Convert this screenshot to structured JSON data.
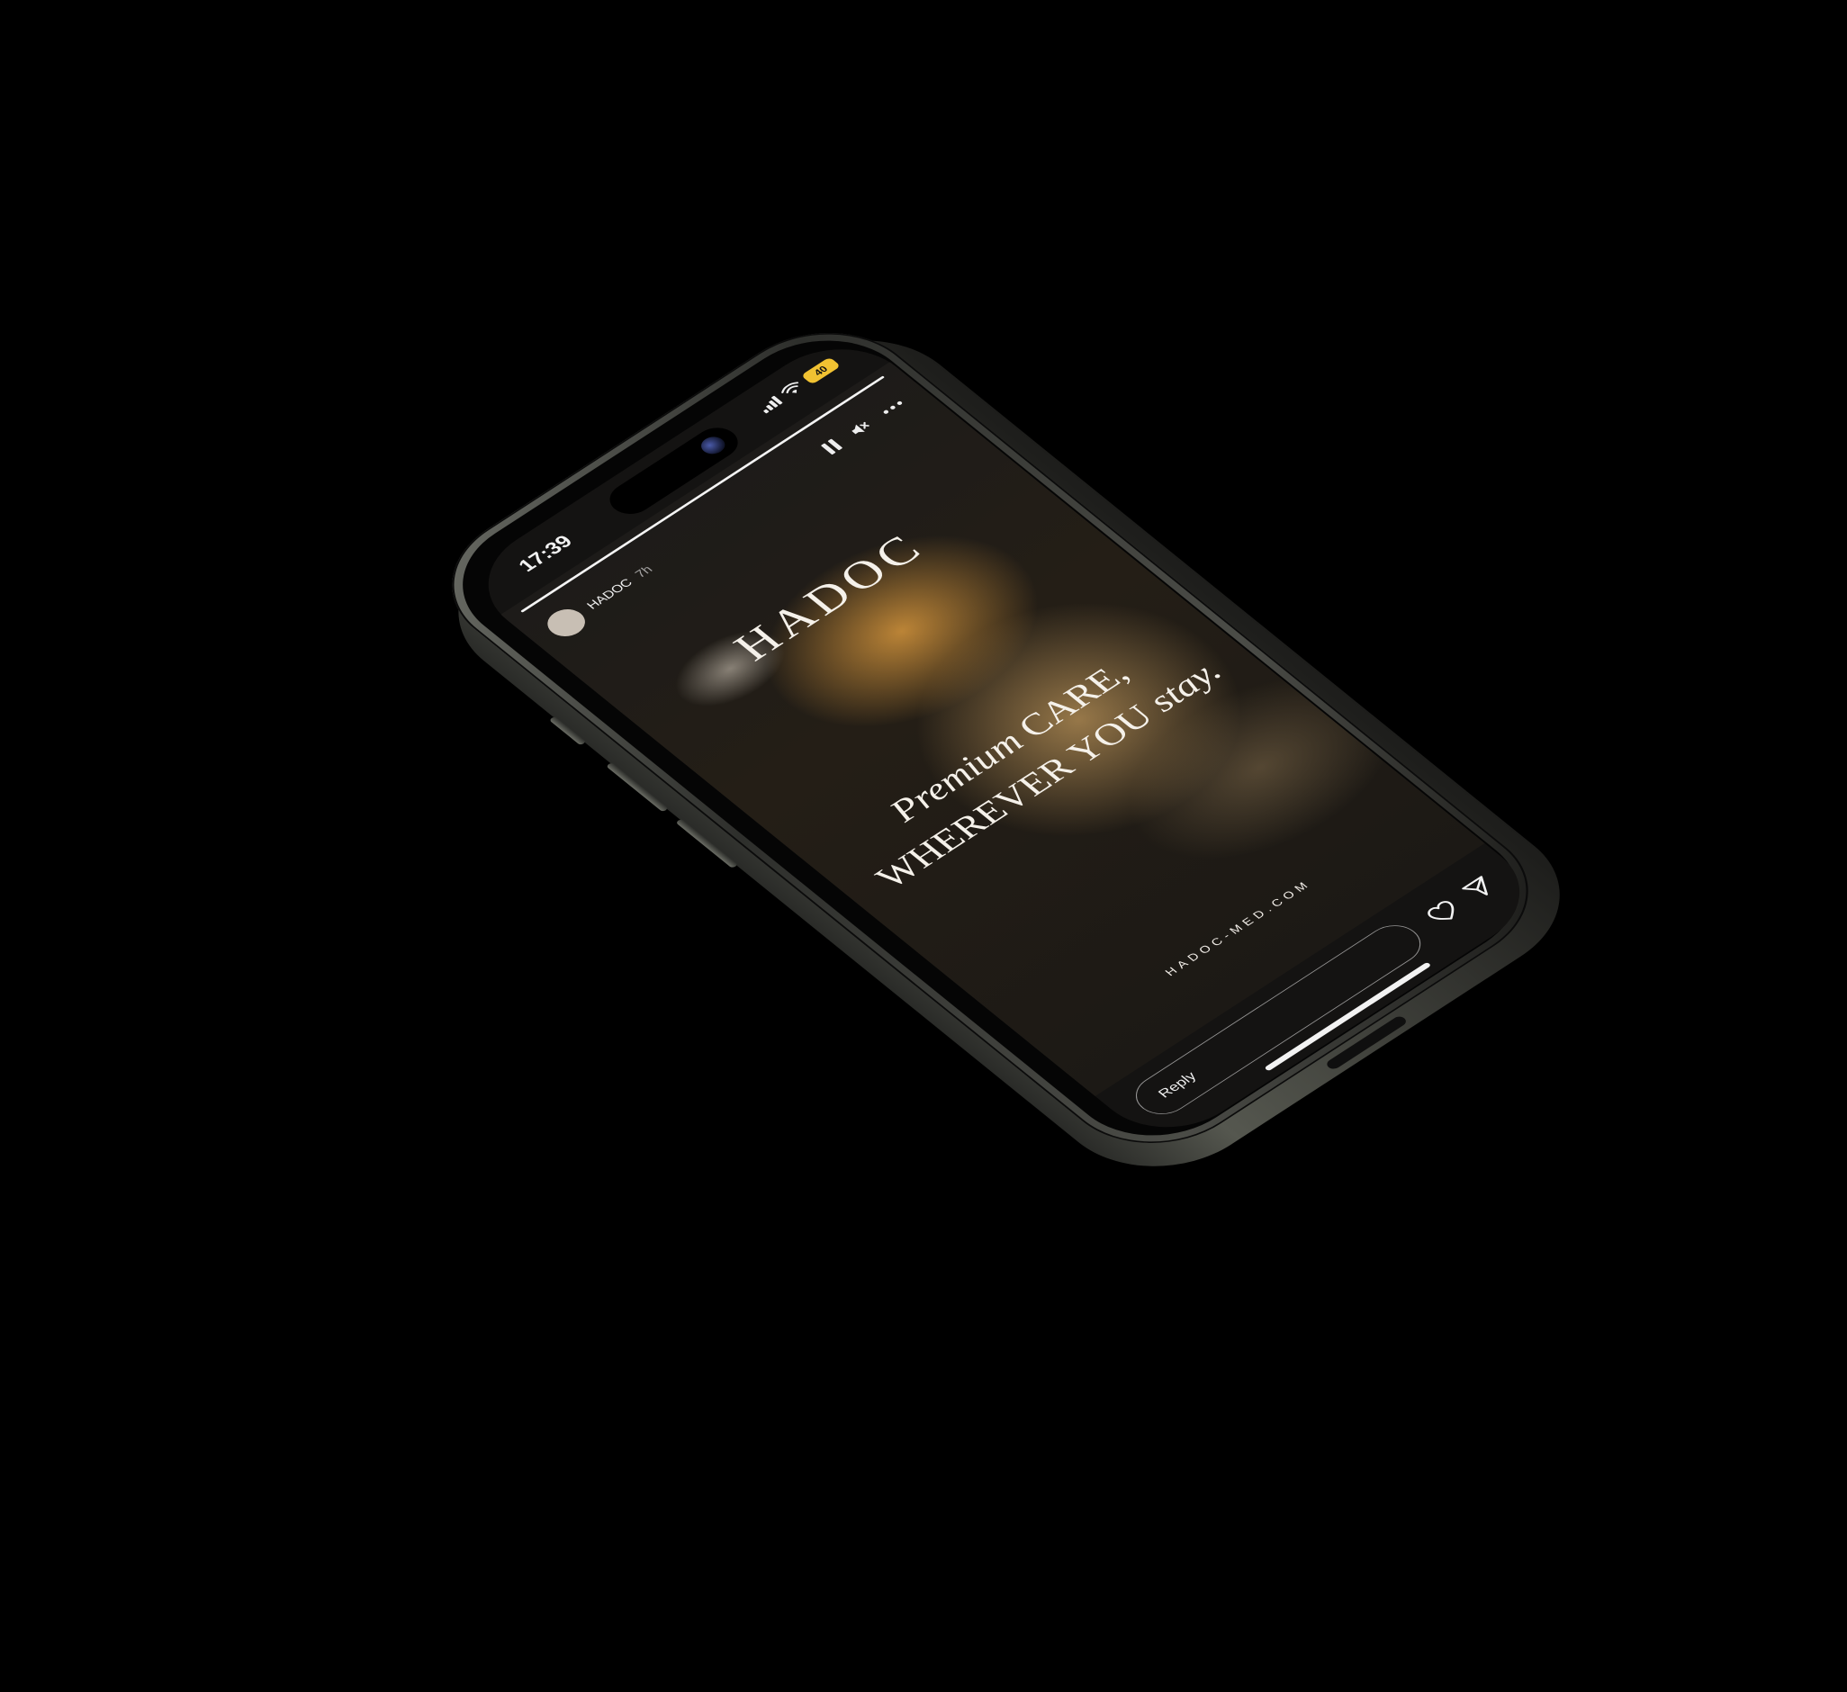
{
  "status_bar": {
    "time": "17:39",
    "battery_level": "40",
    "icons": [
      "cellular-signal-icon",
      "wifi-icon",
      "battery-icon"
    ]
  },
  "story": {
    "account_name": "HADOC",
    "post_age": "7h",
    "progress_fraction": 1.0,
    "controls": [
      "pause-icon",
      "mute-icon",
      "more-options-icon"
    ]
  },
  "content": {
    "brand_logo": "HADOC",
    "tagline_line1_italic": "Premium",
    "tagline_line1_rest": "CARE,",
    "tagline_line2_caps": "WHEREVER YOU",
    "tagline_line2_italic": "stay.",
    "website_url": "HADOC-MED.COM"
  },
  "reply_bar": {
    "placeholder": "Reply",
    "actions": [
      "heart-icon",
      "send-icon"
    ]
  },
  "colors": {
    "background": "#000000",
    "screen_bg": "#141312",
    "accent_amber": "#d6963c",
    "battery": "#f1c232",
    "text_primary": "#f5f1ea"
  }
}
